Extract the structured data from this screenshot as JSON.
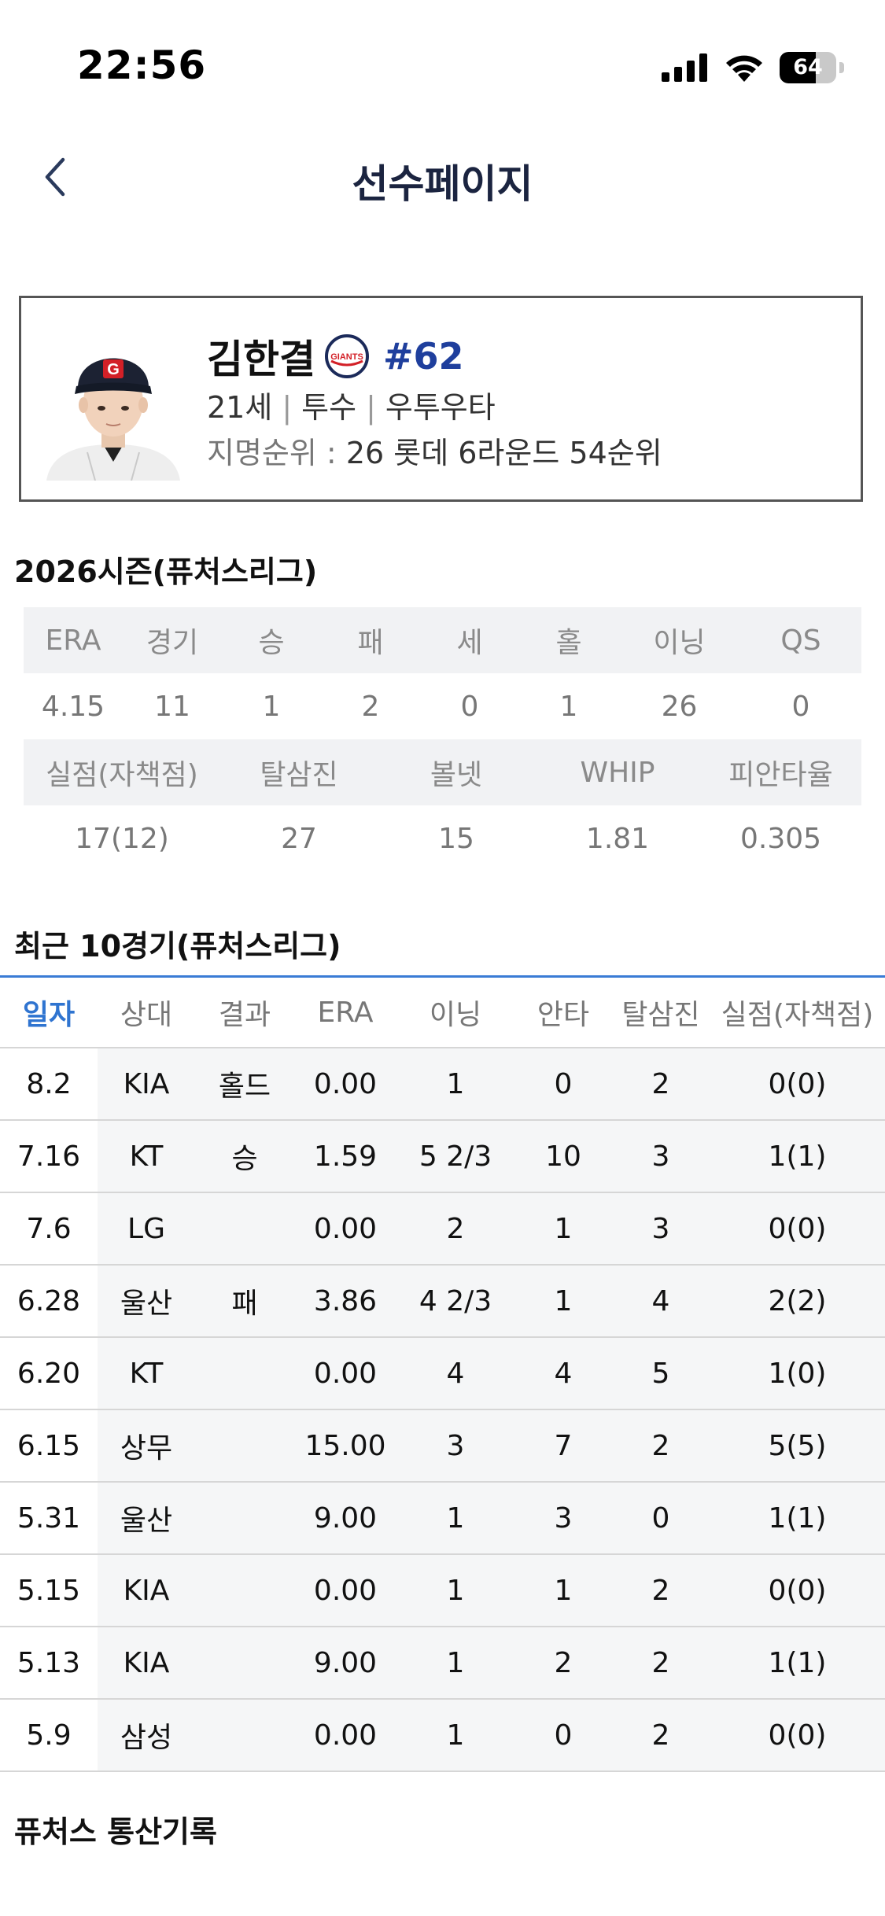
{
  "status_bar": {
    "time": "22:56",
    "battery": "64",
    "battery_level": 0.64
  },
  "header": {
    "title": "선수페이지"
  },
  "player": {
    "name": "김한결",
    "number": "#62",
    "age": "21세",
    "position": "투수",
    "bats_throws": "우투우타",
    "draft_label": "지명순위 :",
    "draft_value": "26 롯데 6라운드 54순위",
    "team_logo_text": "GIANTS"
  },
  "season": {
    "title": "2026시즌(퓨처스리그)",
    "row1_headers": [
      "ERA",
      "경기",
      "승",
      "패",
      "세",
      "홀",
      "이닝",
      "QS"
    ],
    "row1_values": [
      "4.15",
      "11",
      "1",
      "2",
      "0",
      "1",
      "26",
      "0"
    ],
    "row2_headers": [
      "실점(자책점)",
      "탈삼진",
      "볼넷",
      "WHIP",
      "피안타율"
    ],
    "row2_values": [
      "17(12)",
      "27",
      "15",
      "1.81",
      "0.305"
    ]
  },
  "recent": {
    "title": "최근 10경기(퓨처스리그)",
    "headers": [
      "일자",
      "상대",
      "결과",
      "ERA",
      "이닝",
      "안타",
      "탈삼진",
      "실점(자책점)"
    ],
    "rows": [
      [
        "8.2",
        "KIA",
        "홀드",
        "0.00",
        "1",
        "0",
        "2",
        "0(0)"
      ],
      [
        "7.16",
        "KT",
        "승",
        "1.59",
        "5 2/3",
        "10",
        "3",
        "1(1)"
      ],
      [
        "7.6",
        "LG",
        "",
        "0.00",
        "2",
        "1",
        "3",
        "0(0)"
      ],
      [
        "6.28",
        "울산",
        "패",
        "3.86",
        "4 2/3",
        "1",
        "4",
        "2(2)"
      ],
      [
        "6.20",
        "KT",
        "",
        "0.00",
        "4",
        "4",
        "5",
        "1(0)"
      ],
      [
        "6.15",
        "상무",
        "",
        "15.00",
        "3",
        "7",
        "2",
        "5(5)"
      ],
      [
        "5.31",
        "울산",
        "",
        "9.00",
        "1",
        "3",
        "0",
        "1(1)"
      ],
      [
        "5.15",
        "KIA",
        "",
        "0.00",
        "1",
        "1",
        "2",
        "0(0)"
      ],
      [
        "5.13",
        "KIA",
        "",
        "9.00",
        "1",
        "2",
        "2",
        "1(1)"
      ],
      [
        "5.9",
        "삼성",
        "",
        "0.00",
        "1",
        "0",
        "2",
        "0(0)"
      ]
    ]
  },
  "career": {
    "title": "퓨처스 통산기록"
  },
  "colors": {
    "accent": "#2f74d0",
    "title": "#1b2440",
    "number": "#1f3f9d"
  }
}
